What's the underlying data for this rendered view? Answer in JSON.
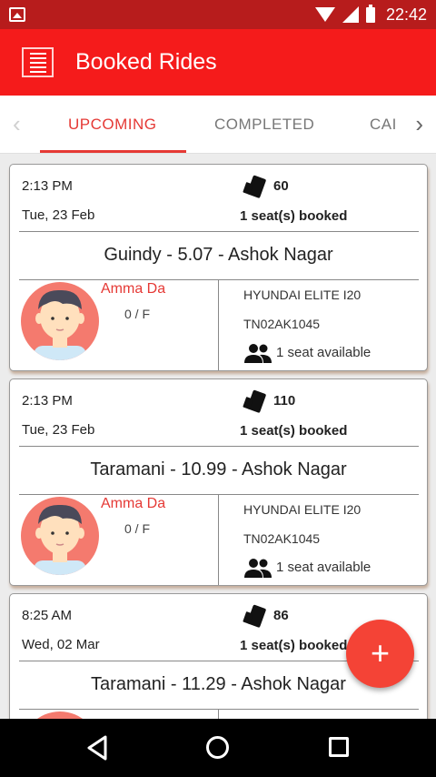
{
  "status_bar": {
    "time": "22:42"
  },
  "app_bar": {
    "title": "Booked Rides"
  },
  "tabs": [
    {
      "label": "UPCOMING",
      "active": true
    },
    {
      "label": "COMPLETED",
      "active": false
    },
    {
      "label": "CAI",
      "active": false
    }
  ],
  "rides": [
    {
      "time": "2:13 PM",
      "date": "Tue, 23 Feb",
      "seats_count": "60",
      "booked": "1 seat(s) booked",
      "route": "Guindy - 5.07 - Ashok Nagar",
      "driver": "Amma Da",
      "rating": "0 / F",
      "car_model": "HYUNDAI ELITE I20",
      "car_plate": "TN02AK1045",
      "seat_available": "1 seat available"
    },
    {
      "time": "2:13 PM",
      "date": "Tue, 23 Feb",
      "seats_count": "110",
      "booked": "1 seat(s) booked",
      "route": "Taramani - 10.99 - Ashok Nagar",
      "driver": "Amma Da",
      "rating": "0 / F",
      "car_model": "HYUNDAI ELITE I20",
      "car_plate": "TN02AK1045",
      "seat_available": "1 seat available"
    },
    {
      "time": "8:25 AM",
      "date": "Wed, 02 Mar",
      "seats_count": "86",
      "booked": "1 seat(s) booked",
      "route": "Taramani - 11.29 - Ashok Nagar"
    }
  ],
  "fab": {
    "label": "+"
  },
  "colors": {
    "primary": "#f51b1b",
    "accent": "#e53935",
    "status_bar": "#b71c1c"
  }
}
